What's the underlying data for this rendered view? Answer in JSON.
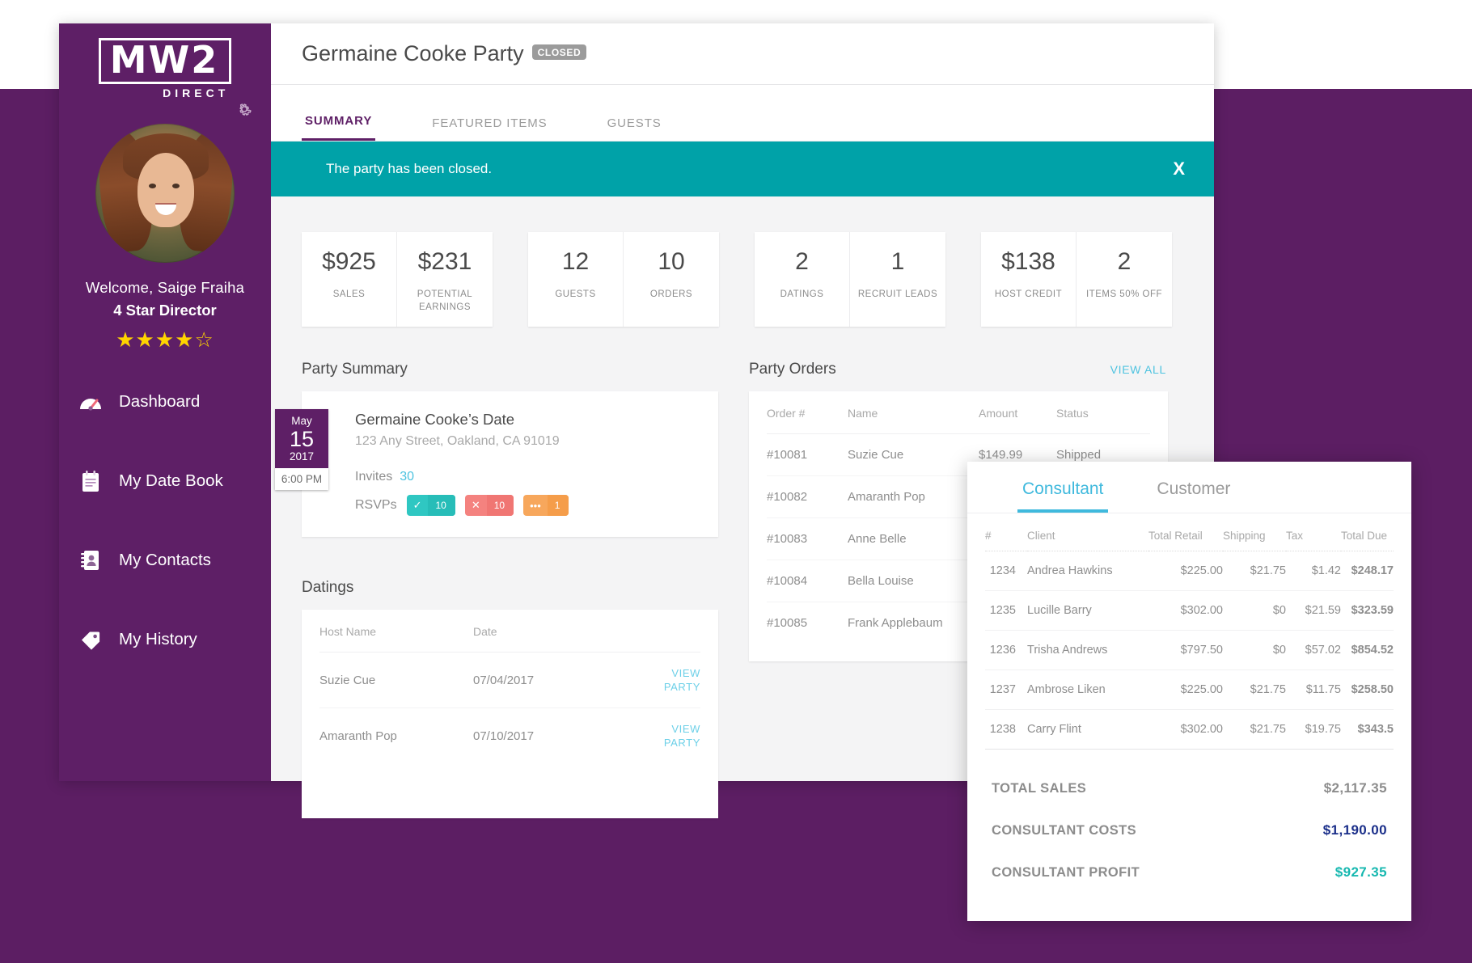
{
  "sidebar": {
    "logo": {
      "mark": "MW2",
      "sub": "DIRECT"
    },
    "settings_icon": "gear-icon",
    "welcome": "Welcome, Saige Fraiha",
    "rank": "4 Star Director",
    "stars": {
      "filled": 4,
      "total": 5
    },
    "items": [
      {
        "label": "Dashboard",
        "icon": "dashboard-icon"
      },
      {
        "label": "My Date Book",
        "icon": "notepad-icon"
      },
      {
        "label": "My Contacts",
        "icon": "contacts-book-icon"
      },
      {
        "label": "My History",
        "icon": "tag-icon"
      }
    ]
  },
  "header": {
    "title": "Germaine Cooke Party",
    "status_badge": "CLOSED"
  },
  "tabs": [
    {
      "label": "SUMMARY",
      "active": true
    },
    {
      "label": "FEATURED ITEMS",
      "active": false
    },
    {
      "label": "GUESTS",
      "active": false
    }
  ],
  "banner": {
    "message": "The party has been closed.",
    "close_label": "X",
    "color": "#00a2a8"
  },
  "stats": [
    {
      "cells": [
        {
          "value": "$925",
          "label": "SALES"
        },
        {
          "value": "$231",
          "label": "POTENTIAL EARNINGS"
        }
      ]
    },
    {
      "cells": [
        {
          "value": "12",
          "label": "GUESTS"
        },
        {
          "value": "10",
          "label": "ORDERS"
        }
      ]
    },
    {
      "cells": [
        {
          "value": "2",
          "label": "DATINGS"
        },
        {
          "value": "1",
          "label": "RECRUIT LEADS"
        }
      ]
    },
    {
      "cells": [
        {
          "value": "$138",
          "label": "HOST CREDIT"
        },
        {
          "value": "2",
          "label": "ITEMS 50% OFF"
        }
      ]
    }
  ],
  "party_summary": {
    "section_title": "Party Summary",
    "date": {
      "month": "May",
      "day": "15",
      "year": "2017",
      "time": "6:00 PM"
    },
    "name": "Germaine Cooke’s Date",
    "address": "123 Any Street, Oakland, CA 91019",
    "invites_label": "Invites",
    "invites_count": "30",
    "rsvp_label": "RSVPs",
    "rsvps": [
      {
        "type": "yes",
        "icon": "check-icon",
        "glyph": "✓",
        "count": "10"
      },
      {
        "type": "no",
        "icon": "x-icon",
        "glyph": "✕",
        "count": "10"
      },
      {
        "type": "maybe",
        "icon": "ellipsis-icon",
        "glyph": "•••",
        "count": "1"
      }
    ]
  },
  "party_orders": {
    "section_title": "Party Orders",
    "view_all": "VIEW ALL",
    "columns": [
      "Order #",
      "Name",
      "Amount",
      "Status"
    ],
    "rows": [
      {
        "order": "#10081",
        "name": "Suzie Cue",
        "amount": "$149.99",
        "status": "Shipped"
      },
      {
        "order": "#10082",
        "name": "Amaranth Pop",
        "amount": "",
        "status": ""
      },
      {
        "order": "#10083",
        "name": "Anne Belle",
        "amount": "",
        "status": ""
      },
      {
        "order": "#10084",
        "name": "Bella Louise",
        "amount": "",
        "status": ""
      },
      {
        "order": "#10085",
        "name": "Frank Applebaum",
        "amount": "",
        "status": ""
      }
    ]
  },
  "datings": {
    "section_title": "Datings",
    "columns": [
      "Host Name",
      "Date",
      ""
    ],
    "rows": [
      {
        "host": "Suzie Cue",
        "date": "07/04/2017",
        "action": "VIEW PARTY"
      },
      {
        "host": "Amaranth Pop",
        "date": "07/10/2017",
        "action": "VIEW PARTY"
      }
    ]
  },
  "overlay": {
    "tabs": [
      {
        "label": "Consultant",
        "active": true
      },
      {
        "label": "Customer",
        "active": false
      }
    ],
    "columns": [
      "#",
      "Client",
      "Total Retail",
      "Shipping",
      "Tax",
      "Total Due"
    ],
    "rows": [
      {
        "num": "1234",
        "client": "Andrea Hawkins",
        "retail": "$225.00",
        "shipping": "$21.75",
        "tax": "$1.42",
        "due": "$248.17"
      },
      {
        "num": "1235",
        "client": "Lucille Barry",
        "retail": "$302.00",
        "shipping": "$0",
        "tax": "$21.59",
        "due": "$323.59"
      },
      {
        "num": "1236",
        "client": "Trisha Andrews",
        "retail": "$797.50",
        "shipping": "$0",
        "tax": "$57.02",
        "due": "$854.52"
      },
      {
        "num": "1237",
        "client": "Ambrose Liken",
        "retail": "$225.00",
        "shipping": "$21.75",
        "tax": "$11.75",
        "due": "$258.50"
      },
      {
        "num": "1238",
        "client": "Carry Flint",
        "retail": "$302.00",
        "shipping": "$21.75",
        "tax": "$19.75",
        "due": "$343.5"
      }
    ],
    "totals": [
      {
        "label": "TOTAL SALES",
        "value": "$2,117.35",
        "color": "#8c8c8c"
      },
      {
        "label": "CONSULTANT COSTS",
        "value": "$1,190.00",
        "color": "#1b2f8a"
      },
      {
        "label": "CONSULTANT PROFIT",
        "value": "$927.35",
        "color": "#17b8b0"
      }
    ]
  },
  "theme": {
    "brand_purple": "#5e1f66",
    "accent_teal": "#00a2a8",
    "link_blue": "#4ec3e0"
  }
}
